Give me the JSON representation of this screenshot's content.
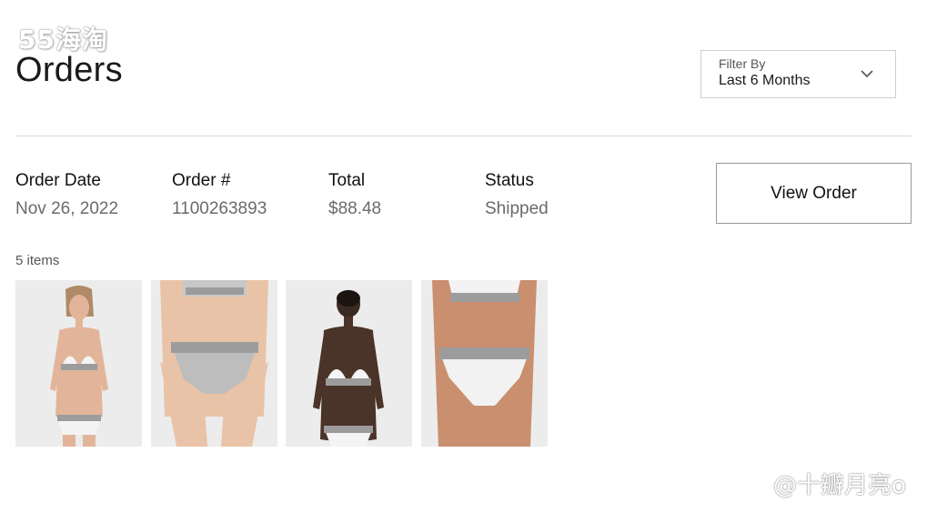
{
  "watermark_top": "55海淘",
  "watermark_bottom": "@十瓣月亮o",
  "page": {
    "title": "Orders"
  },
  "filter": {
    "label": "Filter By",
    "value": "Last 6 Months",
    "icon": "chevron-down-icon"
  },
  "order": {
    "columns": [
      {
        "label": "Order Date",
        "value": "Nov 26, 2022"
      },
      {
        "label": "Order #",
        "value": "1100263893"
      },
      {
        "label": "Total",
        "value": "$88.48"
      },
      {
        "label": "Status",
        "value": "Shipped"
      }
    ],
    "view_button": "View Order",
    "items_count": "5 items"
  },
  "colors": {
    "text": "#111111",
    "muted": "#6b6b6b",
    "border": "#cfcfcf",
    "divider": "#d6d6d6",
    "band": "#9c9c9c"
  }
}
